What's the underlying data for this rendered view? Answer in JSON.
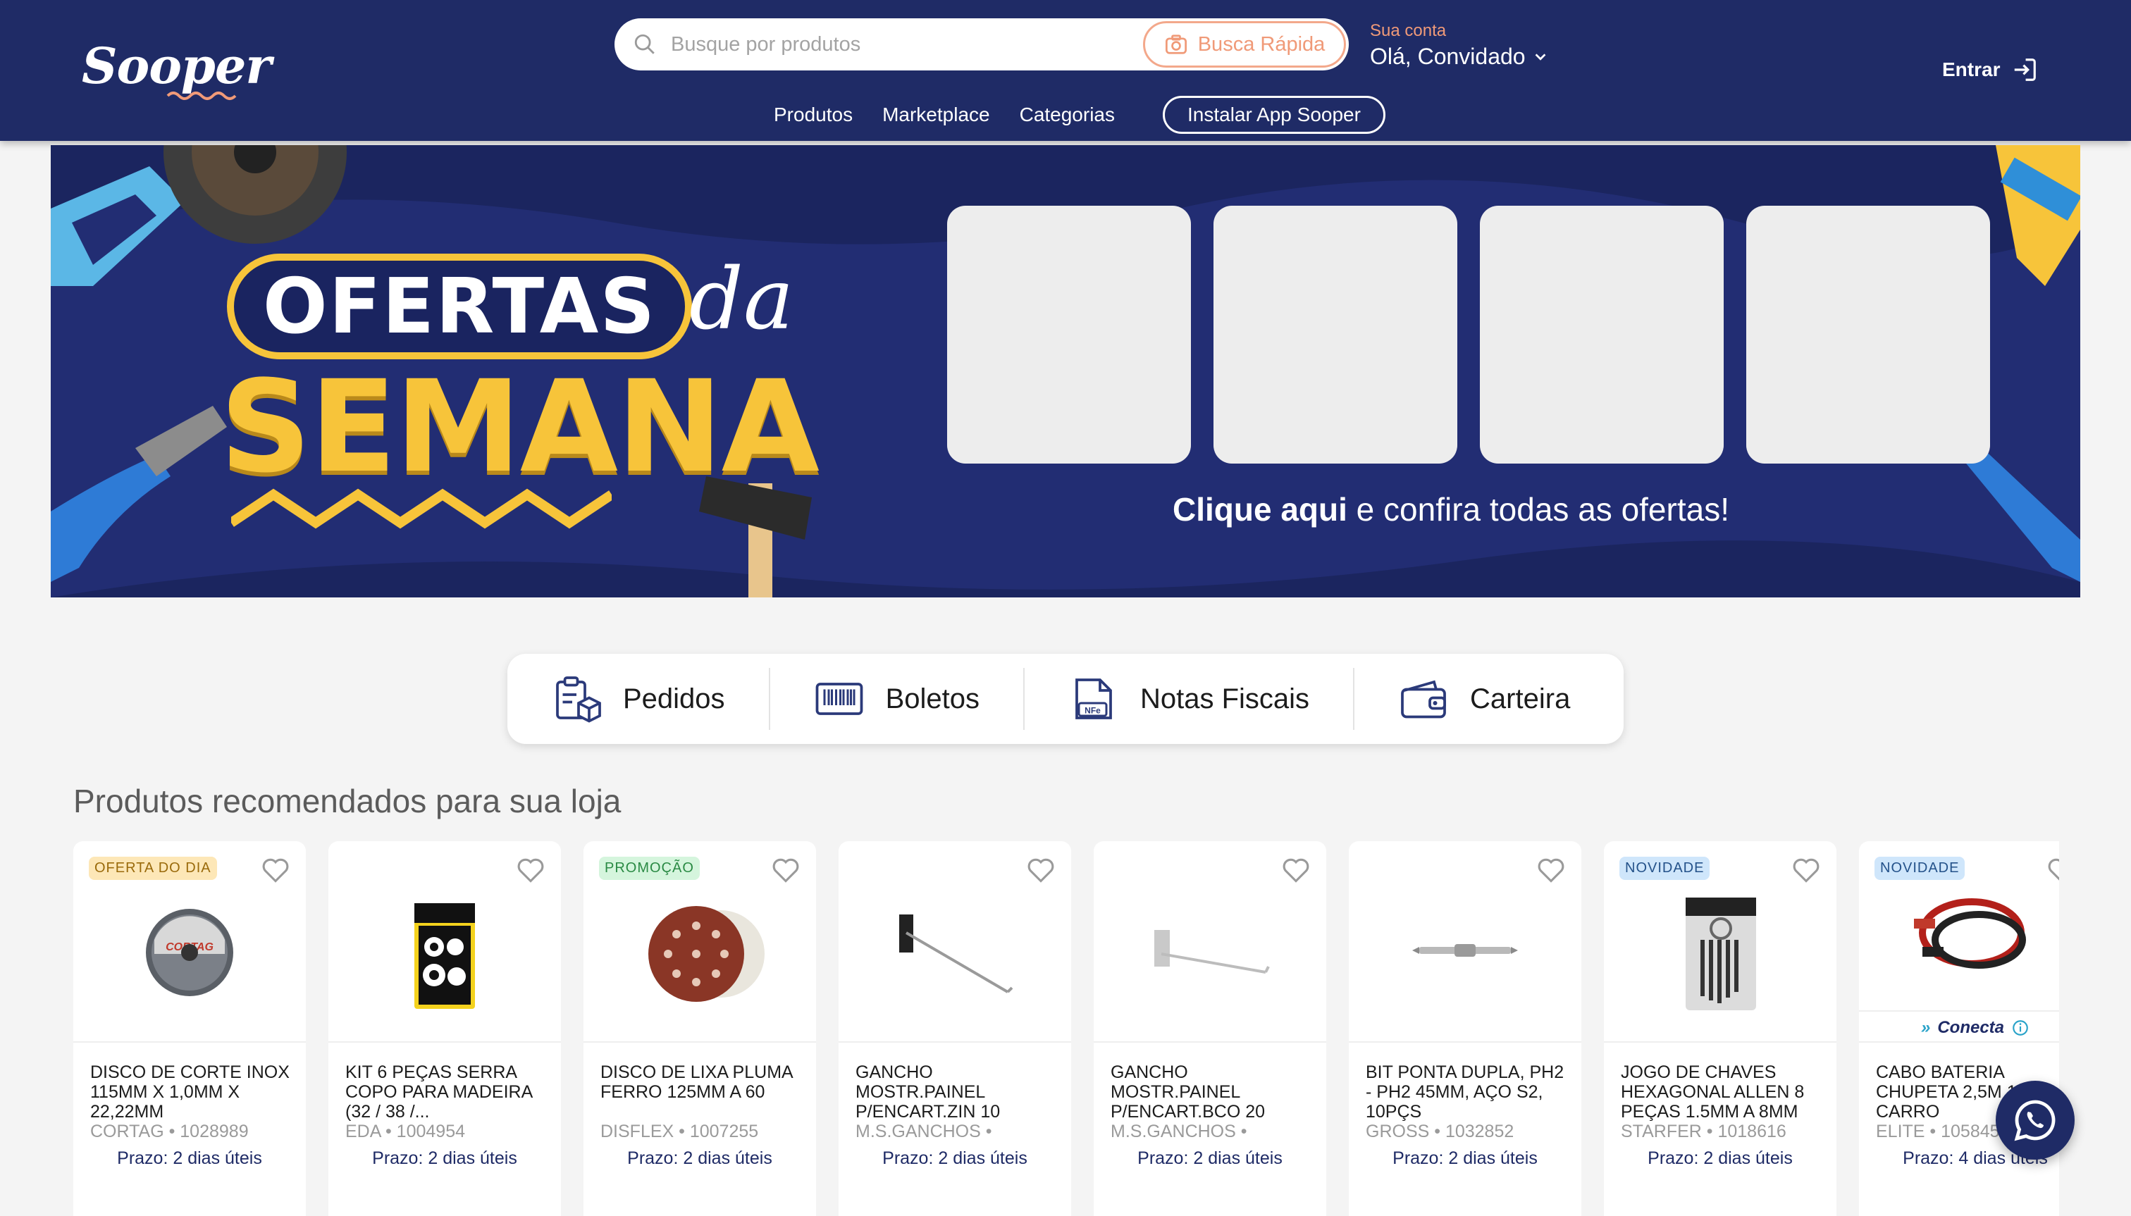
{
  "header": {
    "logo": "Sooper",
    "search_placeholder": "Busque por produtos",
    "quick_search_label": "Busca Rápida",
    "account_label": "Sua conta",
    "account_name": "Olá, Convidado",
    "login_label": "Entrar",
    "nav": [
      "Produtos",
      "Marketplace",
      "Categorias"
    ],
    "install_app_label": "Instalar App Sooper"
  },
  "banner": {
    "title_line1": "OFERTAS",
    "title_script": "da",
    "title_line2": "SEMANA",
    "cta_bold": "Clique aqui",
    "cta_rest": " e confira todas as ofertas!"
  },
  "actions": [
    {
      "label": "Pedidos",
      "icon": "orders-icon"
    },
    {
      "label": "Boletos",
      "icon": "barcode-icon"
    },
    {
      "label": "Notas Fiscais",
      "icon": "nfe-document-icon"
    },
    {
      "label": "Carteira",
      "icon": "wallet-icon"
    }
  ],
  "section_title": "Produtos recomendados para sua loja",
  "products": [
    {
      "badge": "OFERTA DO DIA",
      "badge_type": "oferta",
      "name": "DISCO DE CORTE INOX 115MM X 1,0MM X 22,22MM",
      "meta": "CORTAG • 1028989",
      "prazo": "Prazo: 2 dias úteis",
      "image": "cutting-disc"
    },
    {
      "badge": "",
      "badge_type": "",
      "name": "KIT 6 PEÇAS SERRA COPO PARA MADEIRA (32 / 38 /...",
      "meta": "EDA • 1004954",
      "prazo": "Prazo: 2 dias úteis",
      "image": "hole-saw-kit"
    },
    {
      "badge": "PROMOÇÃO",
      "badge_type": "promo",
      "name": "DISCO DE LIXA PLUMA FERRO 125MM A 60",
      "meta": "DISFLEX • 1007255",
      "prazo": "Prazo: 2 dias úteis",
      "image": "sanding-disc"
    },
    {
      "badge": "",
      "badge_type": "",
      "name": "GANCHO MOSTR.PAINEL P/ENCART.ZIN 10",
      "meta": "M.S.GANCHOS •",
      "prazo": "Prazo: 2 dias úteis",
      "image": "display-hook-black"
    },
    {
      "badge": "",
      "badge_type": "",
      "name": "GANCHO MOSTR.PAINEL P/ENCART.BCO 20",
      "meta": "M.S.GANCHOS •",
      "prazo": "Prazo: 2 dias úteis",
      "image": "display-hook-white"
    },
    {
      "badge": "",
      "badge_type": "",
      "name": "BIT PONTA DUPLA, PH2 - PH2 45MM, AÇO S2, 10PÇS",
      "meta": "GROSS • 1032852",
      "prazo": "Prazo: 2 dias úteis",
      "image": "screwdriver-bit"
    },
    {
      "badge": "NOVIDADE",
      "badge_type": "novidade",
      "name": "JOGO DE CHAVES HEXAGONAL ALLEN 8 PEÇAS 1.5MM A 8MM",
      "meta": "STARFER • 1018616",
      "prazo": "Prazo: 2 dias úteis",
      "image": "allen-key-set"
    },
    {
      "badge": "NOVIDADE",
      "badge_type": "novidade",
      "name": "CABO BATERIA CHUPETA 2,5M 1... CARRO",
      "meta": "ELITE • 105845...",
      "prazo": "Prazo: 4 dias úteis",
      "image": "jumper-cables",
      "conecta": "Conecta"
    }
  ],
  "colors": {
    "navy": "#1f2b66",
    "accent_orange": "#f09a78",
    "banner_yellow": "#f7c43a"
  }
}
